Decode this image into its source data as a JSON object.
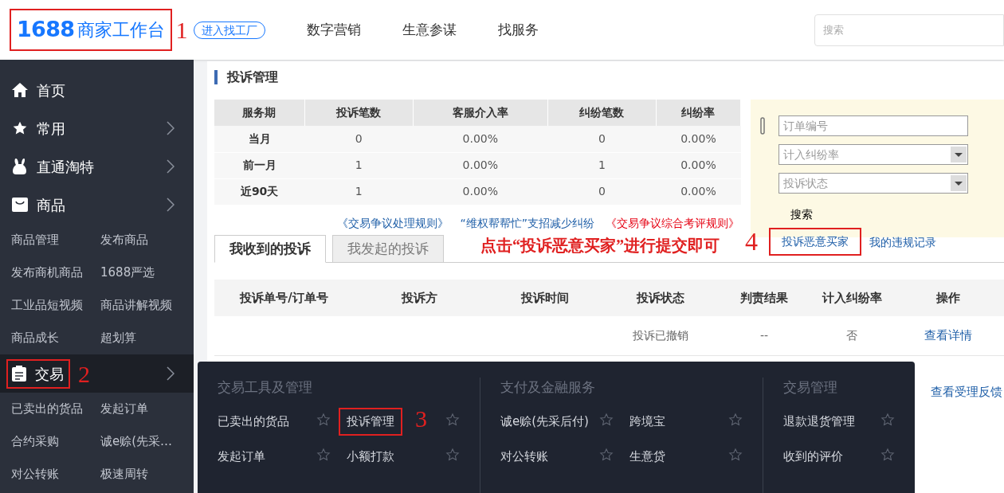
{
  "header": {
    "logo": {
      "number": "1688",
      "name": "商家工作台",
      "annotation": "1"
    },
    "factory_button": "进入找工厂",
    "nav": [
      "数字营销",
      "生意参谋",
      "找服务"
    ],
    "search": {
      "placeholder": "搜索"
    }
  },
  "sidebar": {
    "items": [
      {
        "kind": "menu",
        "label": "首页",
        "has_arrow": false,
        "selected": false
      },
      {
        "kind": "menu",
        "label": "常用",
        "has_arrow": true,
        "selected": false
      },
      {
        "kind": "menu",
        "label": "直通淘特",
        "has_arrow": true,
        "selected": false
      },
      {
        "kind": "menu",
        "label": "商品",
        "has_arrow": true,
        "selected": false
      },
      {
        "kind": "links",
        "links": [
          "商品管理",
          "发布商品"
        ]
      },
      {
        "kind": "links",
        "links": [
          "发布商机商品",
          "1688严选"
        ]
      },
      {
        "kind": "links",
        "links": [
          "工业品短视频",
          "商品讲解视频"
        ]
      },
      {
        "kind": "links",
        "links": [
          "商品成长",
          "超划算"
        ]
      },
      {
        "kind": "menu",
        "label": "交易",
        "has_arrow": true,
        "selected": true,
        "annotation": "2"
      },
      {
        "kind": "links",
        "links": [
          "已卖出的货品",
          "发起订单"
        ]
      },
      {
        "kind": "links",
        "links": [
          "合约采购",
          "诚e赊(先采…"
        ]
      },
      {
        "kind": "links",
        "links": [
          "对公转账",
          "极速周转"
        ]
      }
    ]
  },
  "page": {
    "title": "投诉管理",
    "stats": {
      "columns": [
        "服务期",
        "投诉笔数",
        "客服介入率",
        "纠纷笔数",
        "纠纷率"
      ],
      "rows": [
        [
          "当月",
          "0",
          "0.00%",
          "0",
          "0.00%"
        ],
        [
          "前一月",
          "1",
          "0.00%",
          "1",
          "0.00%"
        ],
        [
          "近90天",
          "1",
          "0.00%",
          "0",
          "0.00%"
        ]
      ]
    },
    "filters": {
      "order_field": {
        "placeholder": "订单编号"
      },
      "dispute_select": {
        "placeholder": "计入纠纷率"
      },
      "status_select": {
        "placeholder": "投诉状态"
      },
      "search_button": "搜索"
    },
    "rule_links": [
      {
        "label": "《交易争议处理规则》",
        "color": "#1f5fa8"
      },
      {
        "label": "“维权帮帮忙”支招减少纠纷",
        "color": "#1f5fa8"
      },
      {
        "label": "《交易争议综合考评规则》",
        "color": "#e60012"
      }
    ],
    "tabs": [
      {
        "label": "我收到的投诉",
        "selected": true
      },
      {
        "label": "我发起的投诉",
        "selected": false
      }
    ],
    "instruction": "点击“投诉恶意买家”进行提交即可",
    "instruction_annotation": "4",
    "report_link": "投诉恶意买家",
    "violations_link": "我的违规记录",
    "table": {
      "columns": [
        "投诉单号/订单号",
        "投诉方",
        "投诉时间",
        "投诉状态",
        "判责结果",
        "计入纠纷率",
        "操作"
      ],
      "rows": [
        {
          "status": "投诉已撤销",
          "result": "--",
          "counted": "否",
          "action": "查看详情"
        },
        {
          "action": "查看受理反馈"
        }
      ]
    }
  },
  "dropdown": {
    "sections": [
      {
        "title": "交易工具及管理",
        "items": [
          {
            "label": "已卖出的货品"
          },
          {
            "label": "投诉管理",
            "annotation": "3"
          },
          {
            "label": "发起订单"
          },
          {
            "label": "小额打款"
          }
        ]
      },
      {
        "title": "支付及金融服务",
        "items": [
          {
            "label": "诚e赊(先采后付)"
          },
          {
            "label": "跨境宝"
          },
          {
            "label": "对公转账"
          },
          {
            "label": "生意贷"
          }
        ]
      },
      {
        "title": "交易管理",
        "items": [
          {
            "label": "退款退货管理"
          },
          {
            "label": "收到的评价"
          }
        ]
      }
    ]
  }
}
